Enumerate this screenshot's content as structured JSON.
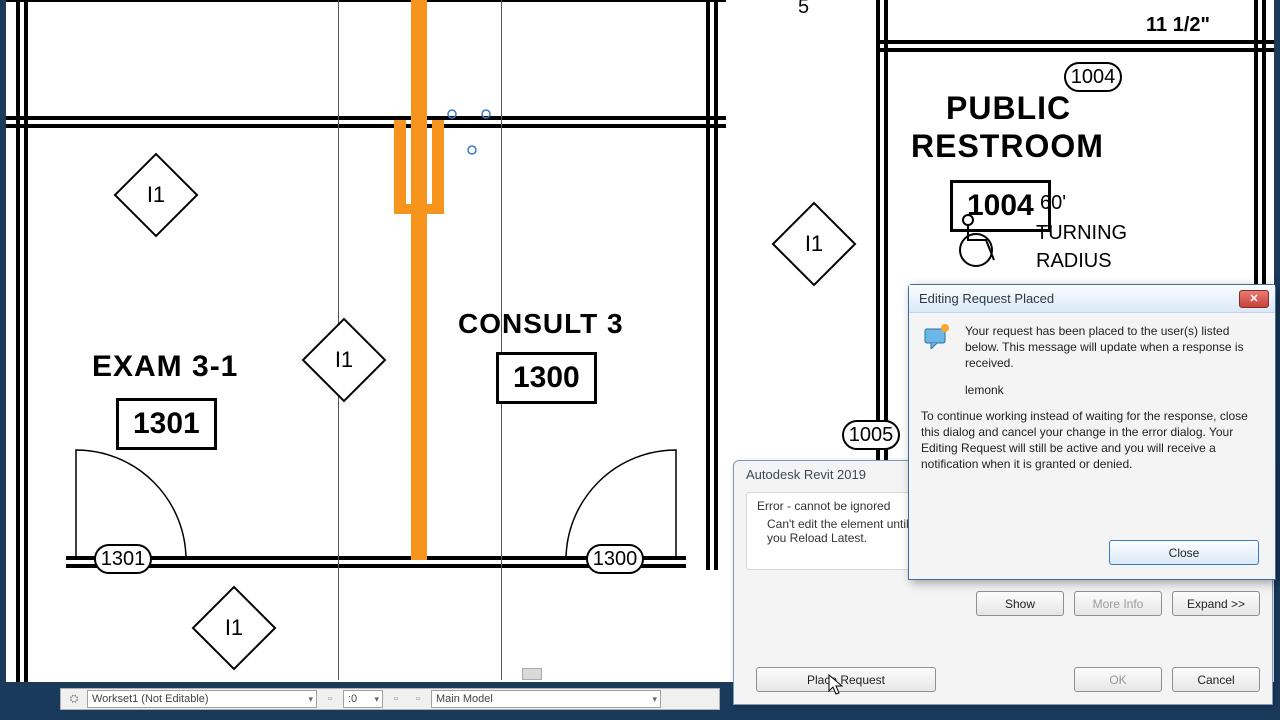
{
  "rooms": {
    "exam": {
      "label": "EXAM 3-1",
      "num": "1301"
    },
    "consult": {
      "label": "CONSULT 3",
      "num": "1300"
    },
    "restroom": {
      "label1": "PUBLIC",
      "label2": "RESTROOM",
      "num": "1004"
    }
  },
  "tags": {
    "i1": "I1",
    "dim1": "11 1/2\"",
    "dim2": "5",
    "turn1": "60'",
    "turn2": "TURNING",
    "turn3": "RADIUS"
  },
  "bubbles": {
    "b1": "1301",
    "b2": "1300",
    "b3": "1005",
    "b4": "1004"
  },
  "status": {
    "workset": "Workset1 (Not Editable)",
    "opt": ":0",
    "model": "Main Model"
  },
  "error_dialog": {
    "title": "Autodesk Revit 2019",
    "heading": "Error - cannot be ignored",
    "msg": "Can't edit the element until 'lemonk' resaves the element to central and relinquishes it and you Reload Latest.",
    "show": "Show",
    "more": "More Info",
    "expand": "Expand >>",
    "place": "Place Request",
    "ok": "OK",
    "cancel": "Cancel"
  },
  "info_dialog": {
    "title": "Editing Request Placed",
    "msg1": "Your request has been placed to the user(s) listed below. This message will update when a response is received.",
    "user": "lemonk",
    "msg2": "To continue working instead of waiting for the response, close this dialog and cancel your change in the error dialog.  Your Editing Request will still be active and you will receive a notification when it is granted or denied.",
    "close": "Close"
  }
}
